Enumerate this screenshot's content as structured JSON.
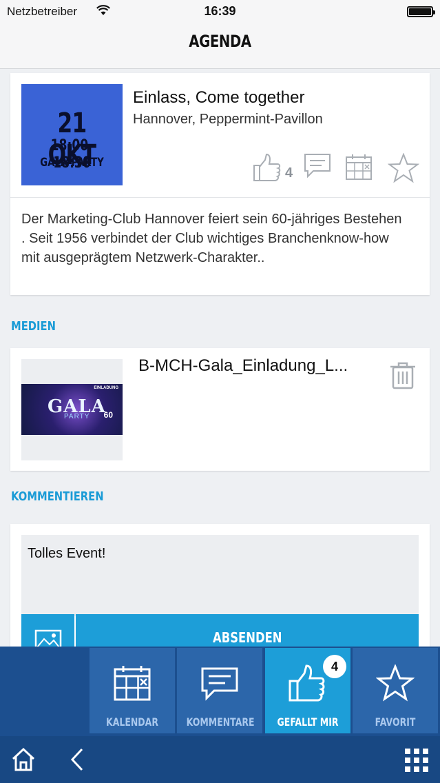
{
  "status_bar": {
    "carrier": "Netzbetreiber",
    "time": "16:39",
    "wifi_icon": "wifi-icon",
    "battery_icon": "battery-icon"
  },
  "header": {
    "title": "AGENDA"
  },
  "event": {
    "date_line": "21 OKT",
    "time_line": "18:00-18:30",
    "tag_line": "GALA-PARTY",
    "tile_color": "#3a63d6",
    "title": "Einlass, Come together",
    "location": "Hannover, Peppermint-Pavillon",
    "like_count": "4",
    "description": "Der Marketing-Club Hannover feiert sein 60-jähriges Bestehen .  Seit 1956 verbindet der Club wichtiges Branchenknow-how mit ausgeprägtem Netzwerk-Charakter.."
  },
  "media": {
    "section_label": "MEDIEN",
    "file_name": "B-MCH-Gala_Einladung_L...",
    "thumb_top_text": "EINLADUNG",
    "thumb_title": "GALA",
    "thumb_subtitle": "PARTY",
    "thumb_number": "60"
  },
  "comment": {
    "section_label": "KOMMENTIEREN",
    "text": "Tolles Event!",
    "send_label": "ABSENDEN"
  },
  "tabbar": {
    "tiles": [
      {
        "label": "KALENDAR",
        "icon": "calendar-icon"
      },
      {
        "label": "KOMMENTARE",
        "icon": "comment-icon"
      },
      {
        "label": "GEFALLT MIR",
        "icon": "thumbs-up-icon",
        "badge": "4",
        "active": true
      },
      {
        "label": "FAVORIT",
        "icon": "star-icon"
      }
    ]
  },
  "colors": {
    "accent": "#1d9ed8",
    "bar": "#1c4f8f",
    "tile": "#2c66aa"
  }
}
